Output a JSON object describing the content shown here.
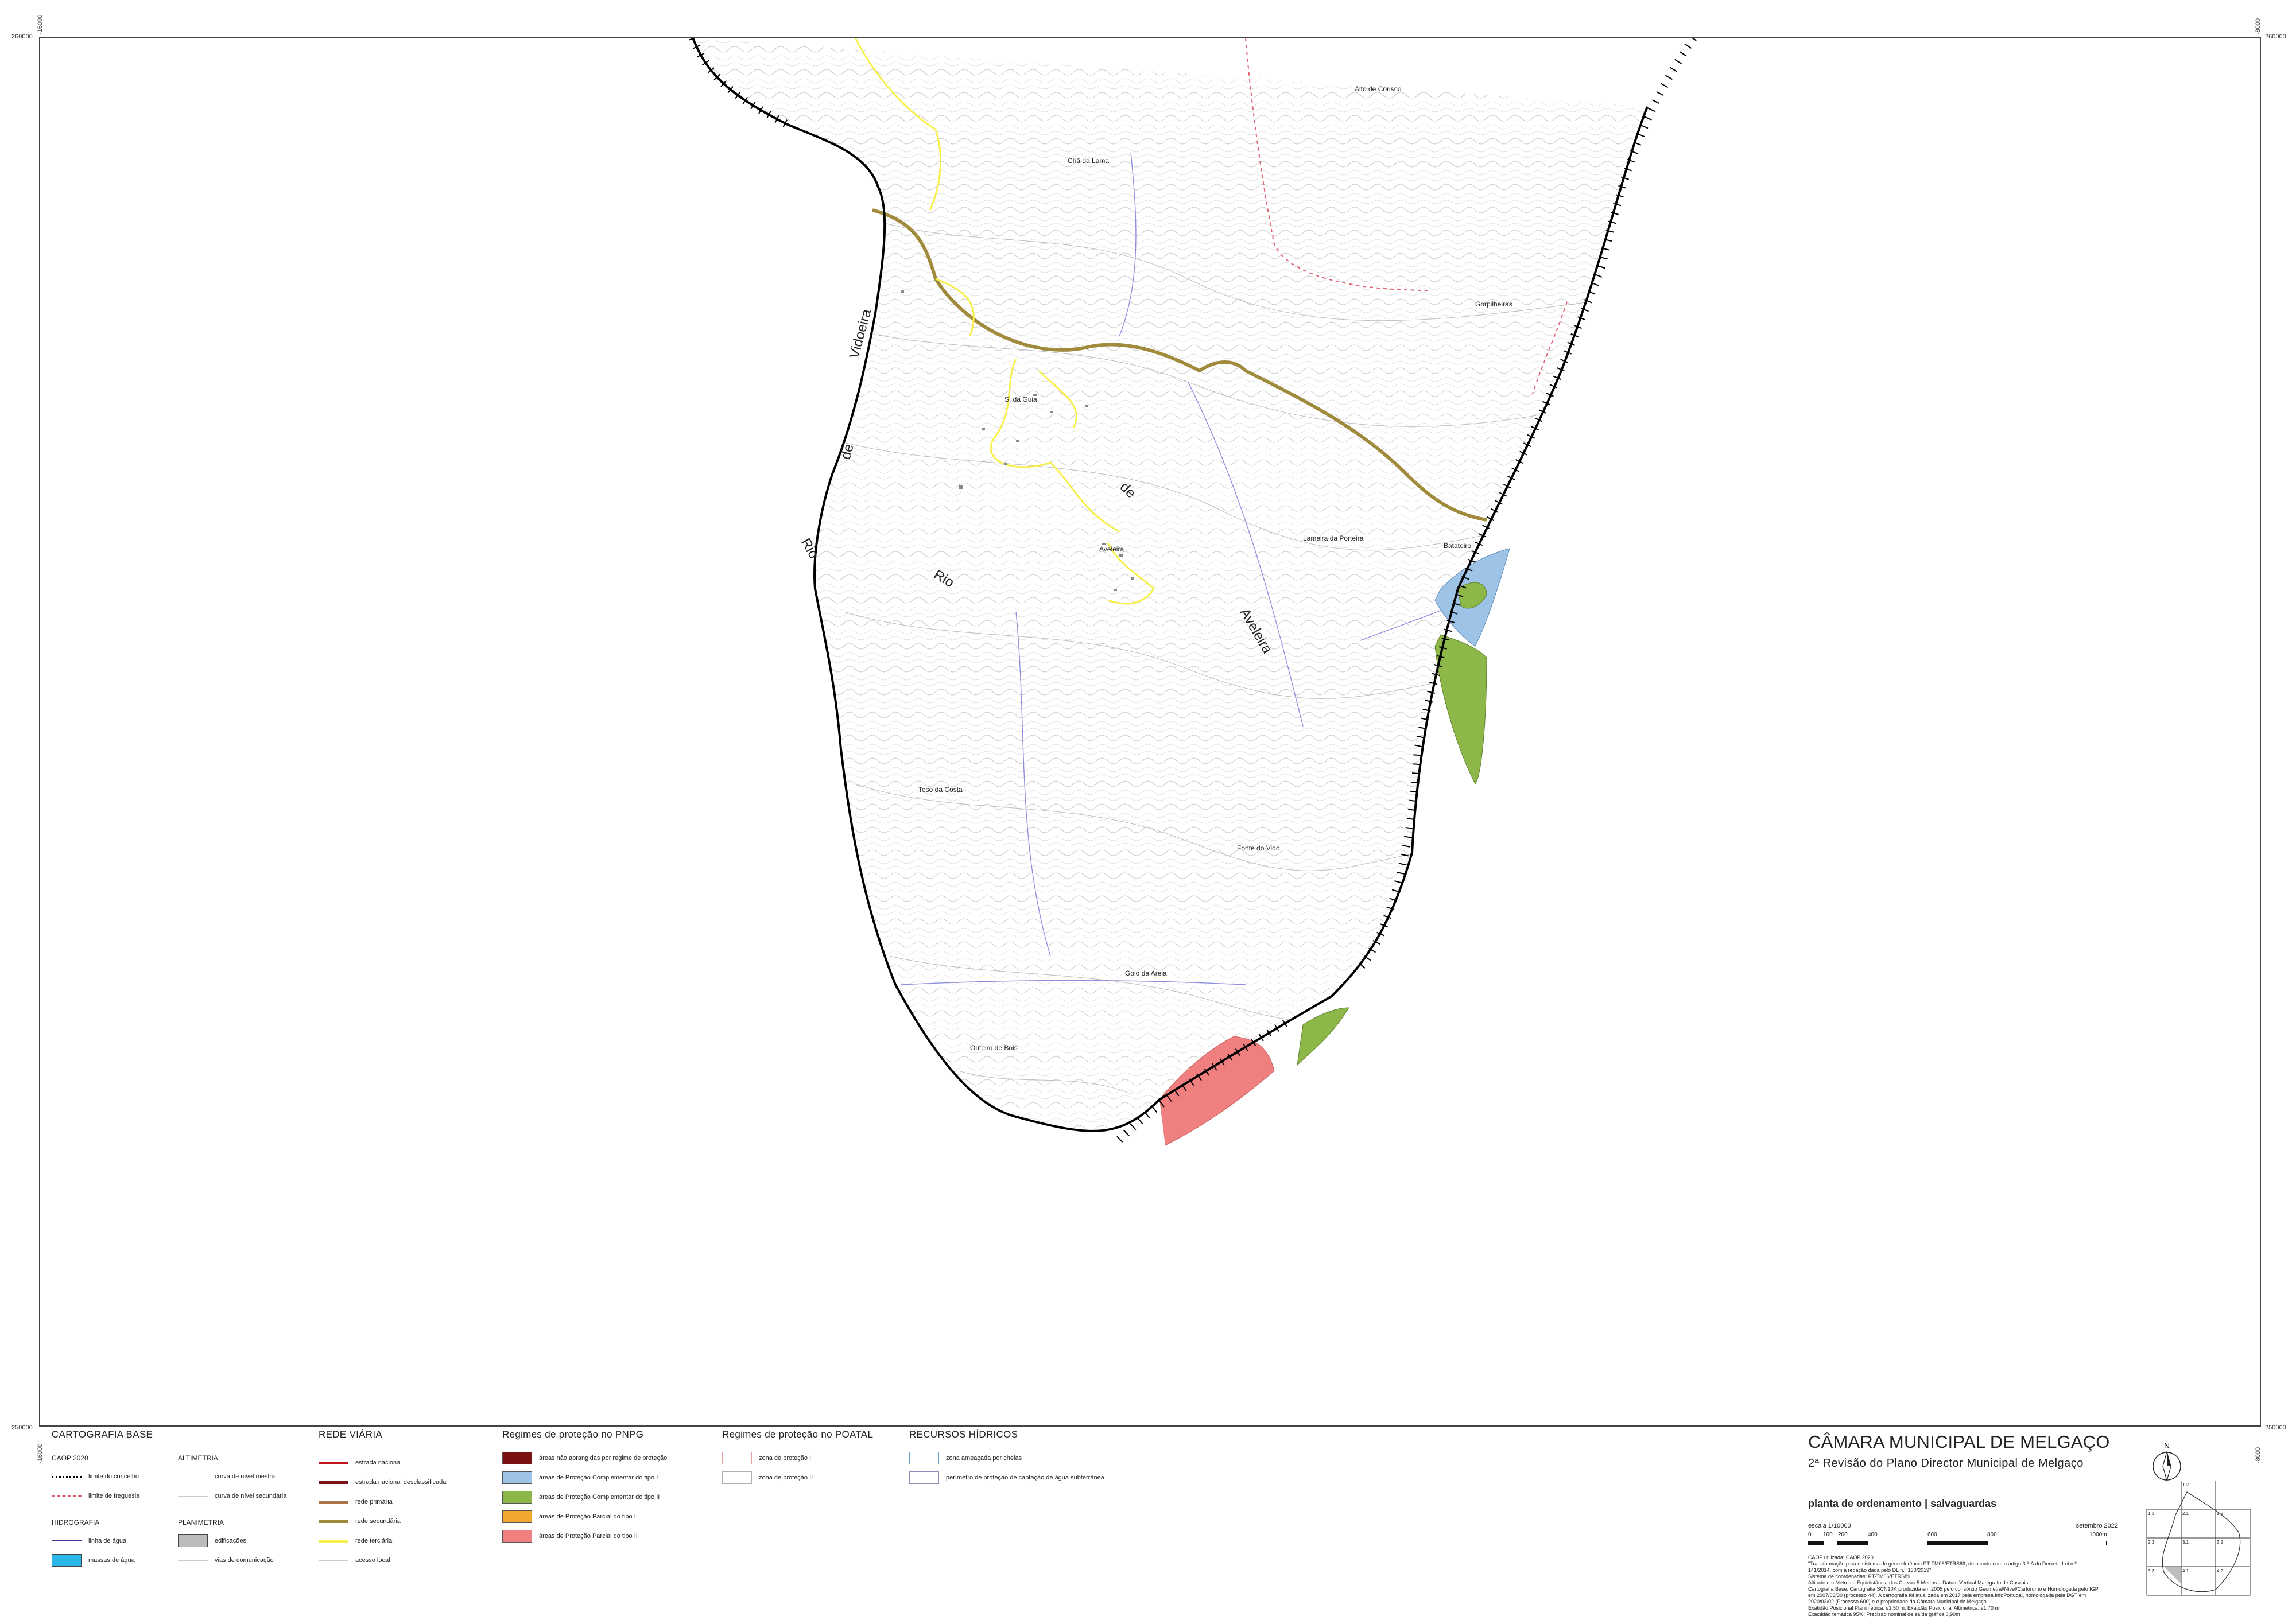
{
  "coords": {
    "top_left_y": "260000",
    "top_left_x": "-16000",
    "top_right_y": "260000",
    "top_right_x": "-8000",
    "bottom_left_y": "250000",
    "bottom_left_x": "-16000",
    "bottom_right_y": "250000",
    "bottom_right_x": "-8000"
  },
  "places": [
    {
      "name": "Alto de Corisco"
    },
    {
      "name": "Chã da Lama"
    },
    {
      "name": "Gorpilheiras"
    },
    {
      "name": "S. da Guia"
    },
    {
      "name": "Aveleira"
    },
    {
      "name": "Lameira da Porteira"
    },
    {
      "name": "Batateiro"
    },
    {
      "name": "Teso da Costa"
    },
    {
      "name": "Fonte do Vido"
    },
    {
      "name": "Golo da Areia"
    },
    {
      "name": "Outeiro de Bois"
    }
  ],
  "river_labels": {
    "vidoeira": "Vidoeira",
    "de1": "de",
    "rio1": "Rio",
    "rio2": "Rio",
    "de2": "de",
    "aveleira": "Aveleira"
  },
  "legend": {
    "cartografia": {
      "title": "CARTOGRAFIA BASE",
      "caop": "CAOP 2020",
      "limite_concelho": "limite do concelho",
      "limite_freguesia": "limite de freguesia",
      "hidrografia": "HIDROGRAFIA",
      "linha_agua": "linha de água",
      "massas_agua": "massas de água",
      "altimetria": "ALTIMETRIA",
      "curva_mestra": "curva de nível mestra",
      "curva_secundaria": "curva de nível secundária",
      "planimetria": "PLANIMETRIA",
      "edificacoes": "edificações",
      "vias": "vias de comunicação"
    },
    "rede_viaria": {
      "title": "REDE VIÁRIA",
      "items": [
        {
          "label": "estrada nacional",
          "color": "#c0141c"
        },
        {
          "label": "estrada nacional desclassificada",
          "color": "#7a1218"
        },
        {
          "label": "rede primária",
          "color": "#a87448"
        },
        {
          "label": "rede secundária",
          "color": "#a08a3c"
        },
        {
          "label": "rede terciária",
          "color": "#f7f04a"
        },
        {
          "label": "acesso local",
          "color": "#cccccc"
        }
      ]
    },
    "pnpg": {
      "title": "Regimes de proteção no PNPG",
      "items": [
        {
          "label": "áreas não abrangidas por regime de proteção",
          "color": "#7b1010"
        },
        {
          "label": "áreas de Proteção Complementar do tipo I",
          "color": "#9dc3e6"
        },
        {
          "label": "áreas de Proteção Complementar do tipo II",
          "color": "#8db849"
        },
        {
          "label": "áreas de Proteção Parcial do tipo I",
          "color": "#f0a830"
        },
        {
          "label": "áreas de Proteção Parcial do tipo II",
          "color": "#f08080"
        }
      ]
    },
    "poatal": {
      "title": "Regimes de proteção no POATAL",
      "items": [
        {
          "label": "zona de proteção I",
          "color": "#e8a0a0"
        },
        {
          "label": "zona de proteção II",
          "color": "#b0b0b0"
        }
      ]
    },
    "recursos": {
      "title": "RECURSOS HÍDRICOS",
      "items": [
        {
          "label": "zona ameaçada por cheias",
          "color": "#6aa0c8"
        },
        {
          "label": "perímetro de proteção de captação de água subterrânea",
          "color": "#8c8cb4"
        }
      ]
    }
  },
  "title_block": {
    "org": "CÂMARA MUNICIPAL DE MELGAÇO",
    "subtitle": "2ª Revisão do Plano Director Municipal de Melgaço",
    "plan": "planta de ordenamento | salvaguardas",
    "scale": "escala 1/10000",
    "date": "setembro 2022",
    "scale_ticks": [
      "0",
      "100",
      "200",
      "400",
      "600",
      "800",
      "1000m"
    ],
    "notes": [
      "CAOP utilizada: CAOP 2020",
      "\"Transformação para o sistema de georreferência PT-TM06/ETRS89, de acordo com o artigo 3.º-A do Decreto-Lei n.º",
      "141/2014, com a redação dada pelo DL n.º 130/2019\"",
      "Sistema de coordenadas: PT-TM06/ETRS89",
      "Altitude em Metros – Equidistância das Curvas 5 Metros – Datum Vertical Marégrafo de Cascais",
      "Cartografia Base: Cartografia SCN10K produzida em 2005 pelo consórcio Geometral/Nível/Cartorumo e Homologada pelo IGP",
      "em 2007/03/30 (processo 44). A cartografia foi atualizada em 2017 pela empresa InfoPortugal, homologada pela DGT em",
      "2020/03/02 (Processo 600) e é propriedade da Câmara Municipal de Melgaço",
      "Exatidão Posicional Planimétrica: ≤1,50 m; Exatidão Posicional Altimétrica: ≤1,70 m",
      "Exactidão temática 95%; Precisão nominal de saída gráfica 0,90m"
    ]
  },
  "north_label": "N",
  "index_map": {
    "labels": [
      "1.2",
      "1.3",
      "2.1",
      "2.2",
      "2.3",
      "3.1",
      "3.2",
      "3.3",
      "4.1",
      "4.2"
    ]
  }
}
